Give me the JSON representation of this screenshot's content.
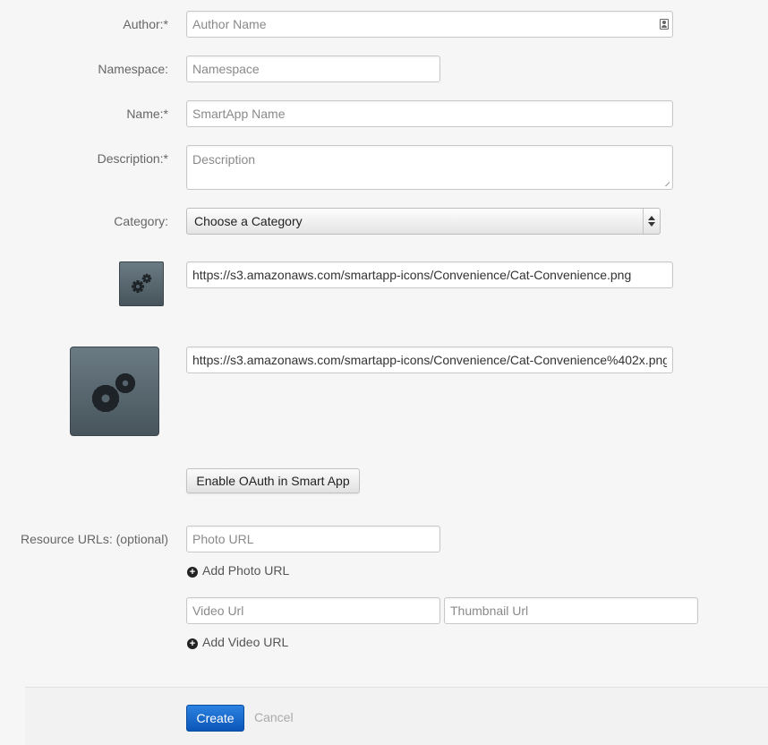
{
  "form": {
    "author": {
      "label": "Author:*",
      "placeholder": "Author Name",
      "value": ""
    },
    "namespace": {
      "label": "Namespace:",
      "placeholder": "Namespace",
      "value": ""
    },
    "name": {
      "label": "Name:*",
      "placeholder": "SmartApp Name",
      "value": ""
    },
    "description": {
      "label": "Description:*",
      "placeholder": "Description",
      "value": ""
    },
    "category": {
      "label": "Category:",
      "selected": "Choose a Category"
    },
    "icon_url": {
      "value": "https://s3.amazonaws.com/smartapp-icons/Convenience/Cat-Convenience.png",
      "icon": "gears-icon"
    },
    "icon_url_2x": {
      "value": "https://s3.amazonaws.com/smartapp-icons/Convenience/Cat-Convenience%402x.png",
      "icon": "gears-icon"
    },
    "oauth_button": "Enable OAuth in Smart App",
    "resources": {
      "label": "Resource URLs: (optional)",
      "photo_placeholder": "Photo URL",
      "add_photo": "Add Photo URL",
      "video_placeholder": "Video Url",
      "thumbnail_placeholder": "Thumbnail Url",
      "add_video": "Add Video URL"
    }
  },
  "footer": {
    "create": "Create",
    "cancel": "Cancel"
  },
  "colors": {
    "primary": "#0a5fc4",
    "icon_bg": "#56656d"
  }
}
